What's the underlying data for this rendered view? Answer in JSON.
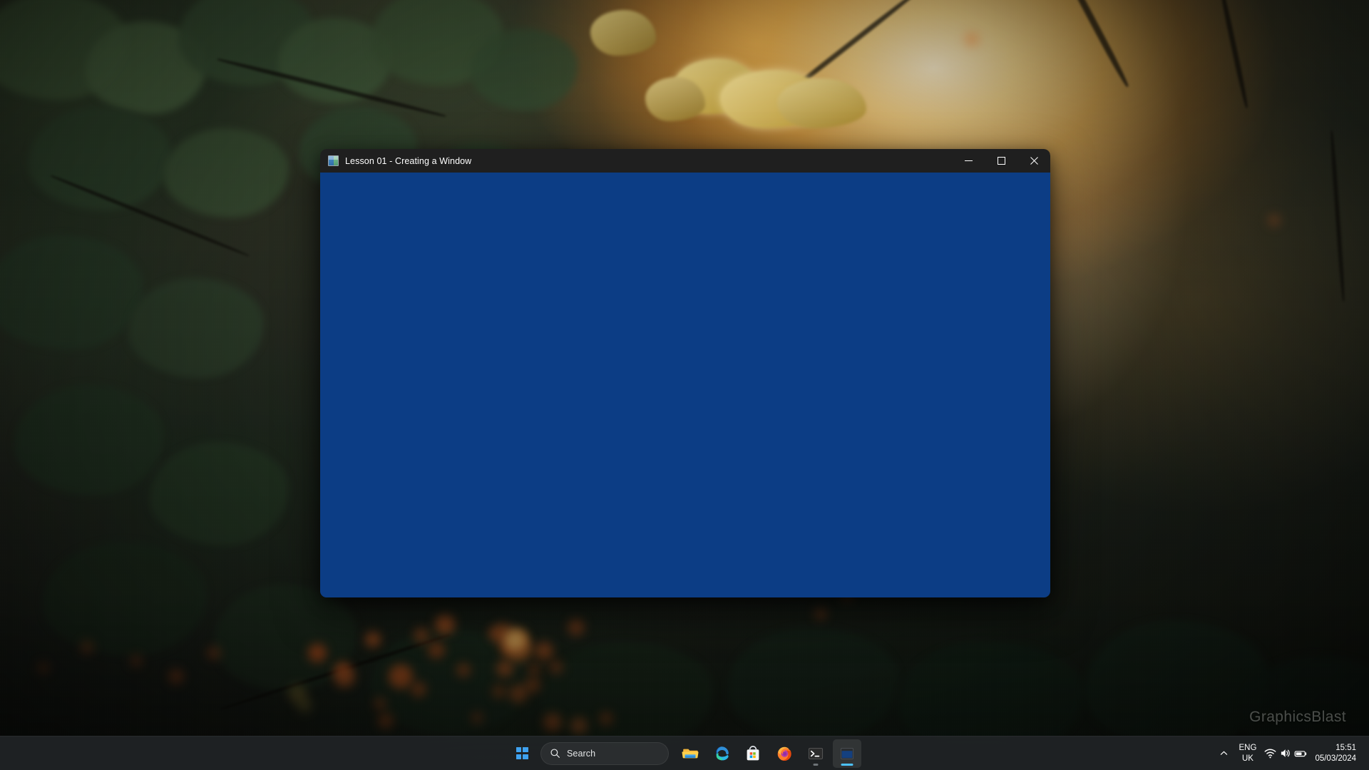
{
  "desktop": {
    "wallpaper_description": "Blurred autumn forest at sunset with backlit leaves and orange bokeh",
    "watermark": "GraphicsBlast",
    "colors": {
      "window_client_blue": "#0c3d85",
      "title_bar": "#1f1f1f",
      "taskbar": "#202426",
      "accent_blue": "#4cc2ff",
      "start_blue": "#3fa2f0"
    }
  },
  "window": {
    "title": "Lesson 01 - Creating a Window",
    "icon": "app-window-icon",
    "controls": {
      "minimize_label": "Minimize",
      "maximize_label": "Maximize",
      "close_label": "Close"
    }
  },
  "taskbar": {
    "start": {
      "label": "Start",
      "icon": "windows-logo-icon"
    },
    "search": {
      "placeholder": "Search",
      "icon": "search-icon"
    },
    "apps": [
      {
        "name": "file-explorer",
        "label": "File Explorer",
        "icon": "folder-icon",
        "state": "idle"
      },
      {
        "name": "microsoft-edge",
        "label": "Microsoft Edge",
        "icon": "edge-icon",
        "state": "idle"
      },
      {
        "name": "microsoft-store",
        "label": "Microsoft Store",
        "icon": "store-icon",
        "state": "idle"
      },
      {
        "name": "firefox",
        "label": "Firefox",
        "icon": "firefox-icon",
        "state": "idle"
      },
      {
        "name": "terminal",
        "label": "Terminal",
        "icon": "terminal-icon",
        "state": "running"
      },
      {
        "name": "lesson-01-app",
        "label": "Lesson 01 - Creating a Window",
        "icon": "app-window-icon",
        "state": "active"
      }
    ]
  },
  "tray": {
    "overflow": {
      "label": "Show hidden icons",
      "icon": "chevron-up-icon"
    },
    "language": {
      "line1": "ENG",
      "line2": "UK"
    },
    "network": {
      "label": "Network",
      "icon": "wifi-icon"
    },
    "volume": {
      "label": "Volume",
      "icon": "speaker-icon"
    },
    "battery": {
      "label": "Battery",
      "icon": "battery-icon"
    },
    "clock": {
      "time": "15:51",
      "date": "05/03/2024"
    }
  }
}
